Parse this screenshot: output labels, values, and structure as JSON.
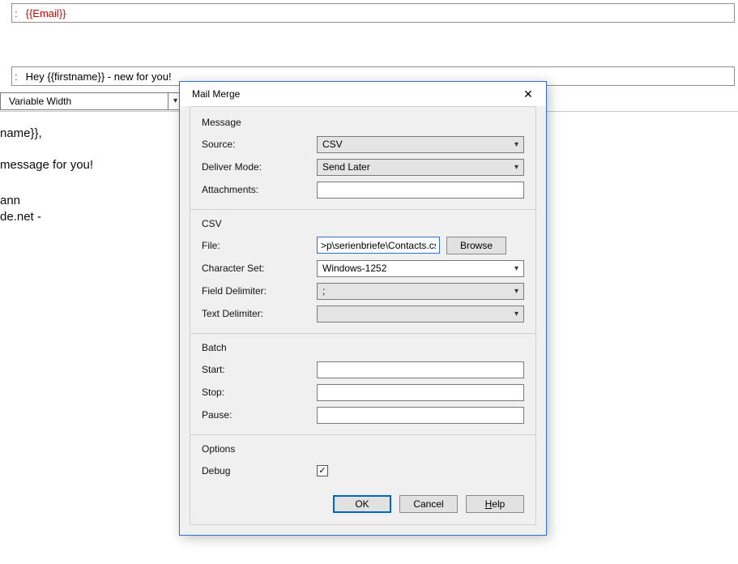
{
  "bg": {
    "to_address": "{{Email}}",
    "subject": "Hey {{firstname}} - new for you!",
    "font_select": "Variable Width",
    "body": {
      "greeting_suffix": "name}},",
      "line1_suffix": "message for you!",
      "sig1": "ann",
      "sig2": "de.net -"
    }
  },
  "dialog": {
    "title": "Mail Merge",
    "groups": {
      "message": {
        "title": "Message",
        "source_label": "Source:",
        "source_value": "CSV",
        "deliver_label": "Deliver Mode:",
        "deliver_value": "Send Later",
        "attachments_label": "Attachments:",
        "attachments_value": ""
      },
      "csv": {
        "title": "CSV",
        "file_label": "File:",
        "file_value": ">p\\serienbriefe\\Contacts.csv",
        "browse": "Browse",
        "charset_label": "Character Set:",
        "charset_value": "Windows-1252",
        "fdelim_label": "Field Delimiter:",
        "fdelim_value": ";",
        "tdelim_label": "Text Delimiter:",
        "tdelim_value": ""
      },
      "batch": {
        "title": "Batch",
        "start_label": "Start:",
        "start_value": "",
        "stop_label": "Stop:",
        "stop_value": "",
        "pause_label": "Pause:",
        "pause_value": ""
      },
      "options": {
        "title": "Options",
        "debug_label": "Debug",
        "debug_checked": true
      }
    },
    "buttons": {
      "ok": "OK",
      "cancel": "Cancel",
      "help": "Help"
    }
  }
}
